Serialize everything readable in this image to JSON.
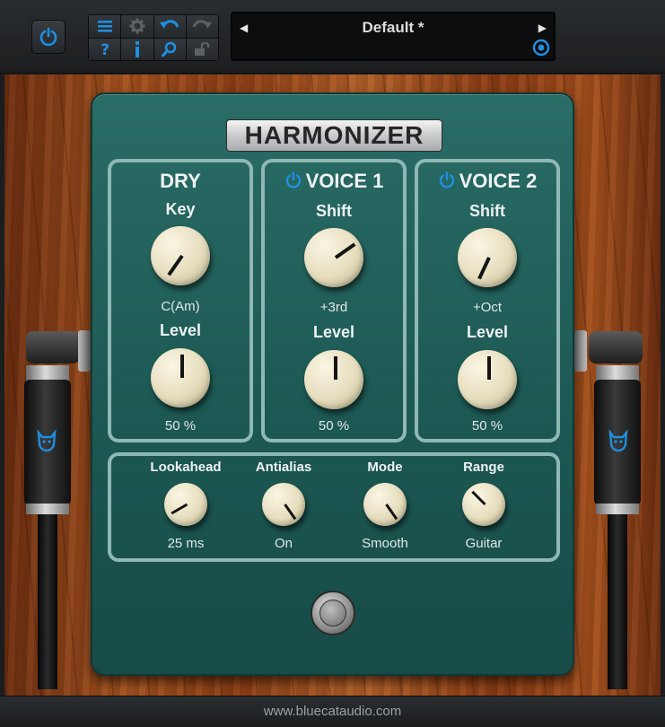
{
  "toolbar": {
    "power_icon": "power-icon",
    "buttons": [
      {
        "name": "menu-button",
        "icon": "menu-icon"
      },
      {
        "name": "settings-button",
        "icon": "gear-icon"
      },
      {
        "name": "undo-button",
        "icon": "undo-icon"
      },
      {
        "name": "redo-button",
        "icon": "redo-icon"
      },
      {
        "name": "help-button",
        "icon": "help-icon"
      },
      {
        "name": "info-button",
        "icon": "info-icon"
      },
      {
        "name": "search-button",
        "icon": "search-icon"
      },
      {
        "name": "lock-button",
        "icon": "lock-icon"
      }
    ],
    "accent_color": "#1f8fe0"
  },
  "preset": {
    "name": "Default *",
    "prev_icon": "triangle-left-icon",
    "next_icon": "triangle-right-icon"
  },
  "pedal": {
    "title": "HARMONIZER",
    "dry": {
      "title": "DRY",
      "key_label": "Key",
      "key_value": "C(Am)",
      "level_label": "Level",
      "level_value": "50 %"
    },
    "voice1": {
      "title": "VOICE 1",
      "shift_label": "Shift",
      "shift_value": "+3rd",
      "level_label": "Level",
      "level_value": "50 %"
    },
    "voice2": {
      "title": "VOICE 2",
      "shift_label": "Shift",
      "shift_value": "+Oct",
      "level_label": "Level",
      "level_value": "50 %"
    },
    "options": {
      "lookahead_label": "Lookahead",
      "lookahead_value": "25 ms",
      "antialias_label": "Antialias",
      "antialias_value": "On",
      "mode_label": "Mode",
      "mode_value": "Smooth",
      "range_label": "Range",
      "range_value": "Guitar"
    }
  },
  "footer": {
    "url": "www.bluecataudio.com"
  }
}
